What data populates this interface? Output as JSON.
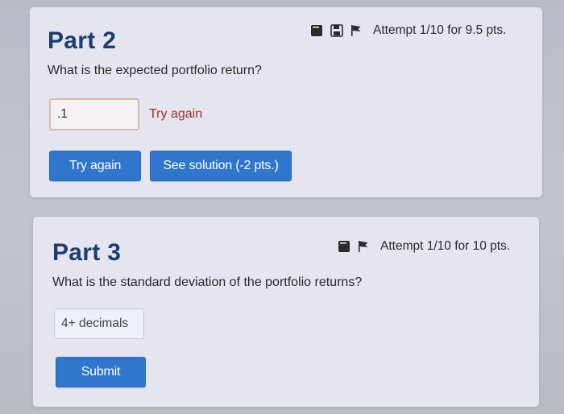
{
  "part2": {
    "title": "Part 2",
    "question": "What is the expected portfolio return?",
    "attempt_text": "Attempt 1/10 for 9.5 pts.",
    "answer_value": ".1",
    "feedback": "Try again",
    "try_again_button": "Try again",
    "solution_button": "See solution (-2 pts.)",
    "icons": [
      "note-icon",
      "save-icon",
      "flag-icon"
    ]
  },
  "part3": {
    "title": "Part 3",
    "question": "What is the standard deviation of the portfolio returns?",
    "attempt_text": "Attempt 1/10 for 10 pts.",
    "answer_placeholder": "4+ decimals",
    "submit_button": "Submit",
    "icons": [
      "note-icon",
      "flag-icon"
    ]
  },
  "colors": {
    "title": "#1d3d6e",
    "button": "#2f76cc",
    "feedback": "#a0302b",
    "card_bg": "#e4e5ef"
  }
}
